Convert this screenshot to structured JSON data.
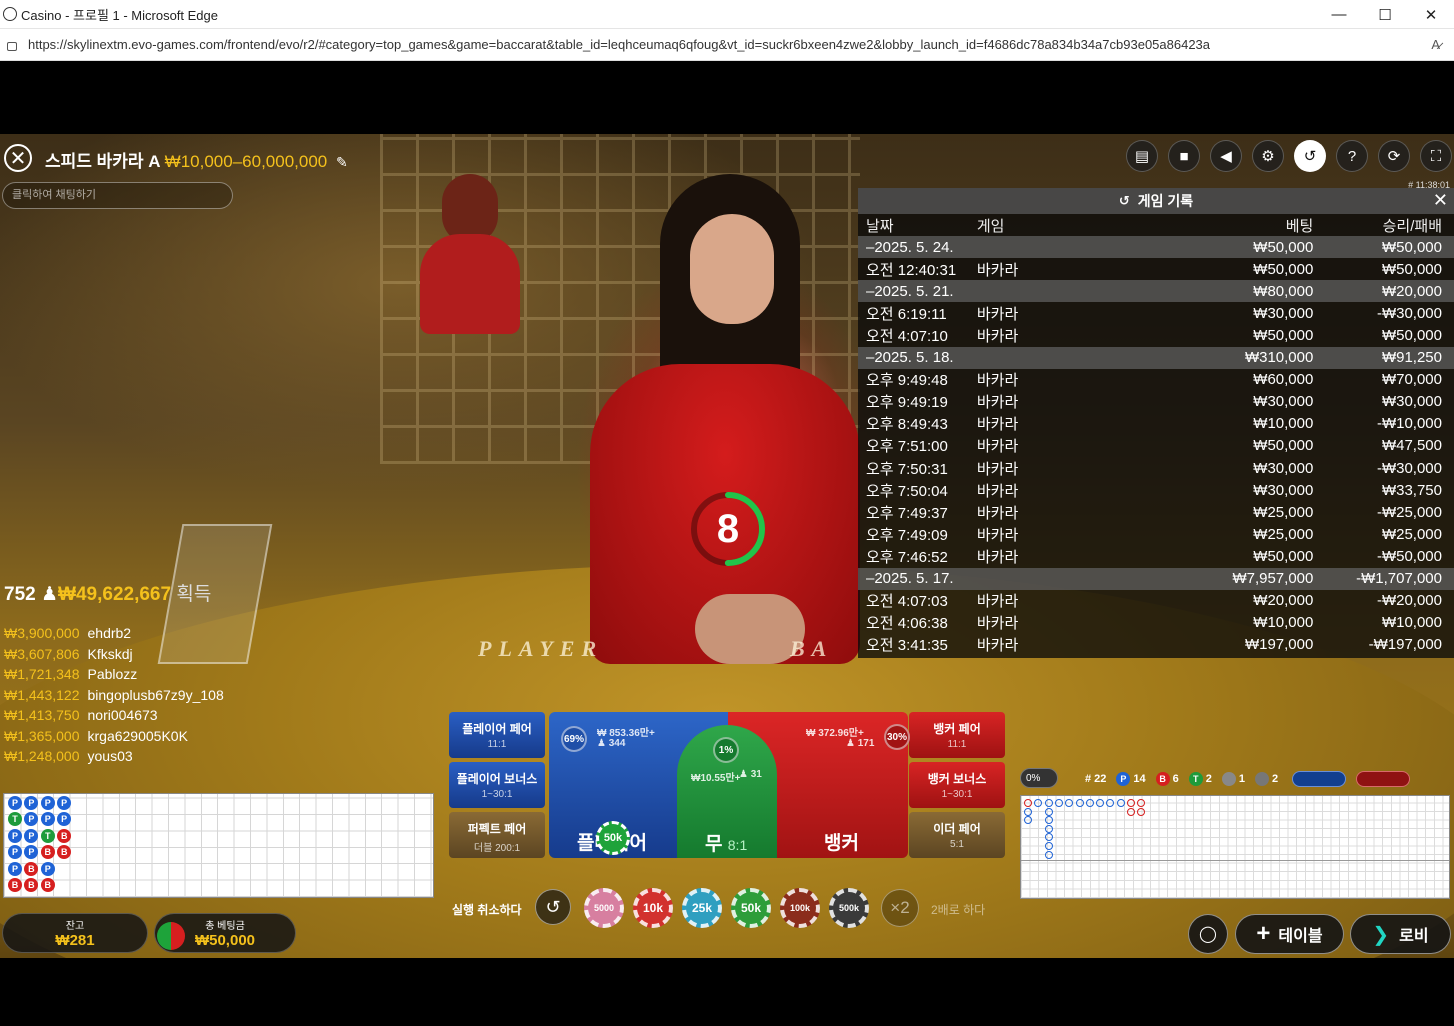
{
  "browser": {
    "title": "Casino - 프로필 1 - Microsoft Edge",
    "url": "https://skylinextm.evo-games.com/frontend/evo/r2/#category=top_games&game=baccarat&table_id=leqhceumaq6qfoug&vt_id=suckr6bxeen4zwe2&lobby_launch_id=f4686dc78a834b34a7cb93e05a86423a",
    "minimize": "—",
    "maximize": "☐",
    "close": "✕",
    "reader": "A̷"
  },
  "header": {
    "table_name": "스피드 바카라 A",
    "limits": "₩10,000–60,000,000",
    "chat_placeholder": "클릭하여 채팅하기",
    "game_id": "# 11:38:01"
  },
  "history": {
    "title": "게임 기록",
    "columns": {
      "date": "날짜",
      "game": "게임",
      "bet": "베팅",
      "result": "승리/패배"
    },
    "rows": [
      {
        "date": "–2025. 5. 24.",
        "game": "",
        "bet": "₩50,000",
        "result": "₩50,000",
        "group": true
      },
      {
        "date": "오전 12:40:31",
        "game": "바카라",
        "bet": "₩50,000",
        "result": "₩50,000"
      },
      {
        "date": "–2025. 5. 21.",
        "game": "",
        "bet": "₩80,000",
        "result": "₩20,000",
        "group": true
      },
      {
        "date": "오전 6:19:11",
        "game": "바카라",
        "bet": "₩30,000",
        "result": "-₩30,000"
      },
      {
        "date": "오전 4:07:10",
        "game": "바카라",
        "bet": "₩50,000",
        "result": "₩50,000"
      },
      {
        "date": "–2025. 5. 18.",
        "game": "",
        "bet": "₩310,000",
        "result": "₩91,250",
        "group": true
      },
      {
        "date": "오후 9:49:48",
        "game": "바카라",
        "bet": "₩60,000",
        "result": "₩70,000"
      },
      {
        "date": "오후 9:49:19",
        "game": "바카라",
        "bet": "₩30,000",
        "result": "₩30,000"
      },
      {
        "date": "오후 8:49:43",
        "game": "바카라",
        "bet": "₩10,000",
        "result": "-₩10,000"
      },
      {
        "date": "오후 7:51:00",
        "game": "바카라",
        "bet": "₩50,000",
        "result": "₩47,500"
      },
      {
        "date": "오후 7:50:31",
        "game": "바카라",
        "bet": "₩30,000",
        "result": "-₩30,000"
      },
      {
        "date": "오후 7:50:04",
        "game": "바카라",
        "bet": "₩30,000",
        "result": "₩33,750"
      },
      {
        "date": "오후 7:49:37",
        "game": "바카라",
        "bet": "₩25,000",
        "result": "-₩25,000"
      },
      {
        "date": "오후 7:49:09",
        "game": "바카라",
        "bet": "₩25,000",
        "result": "₩25,000"
      },
      {
        "date": "오후 7:46:52",
        "game": "바카라",
        "bet": "₩50,000",
        "result": "-₩50,000"
      },
      {
        "date": "–2025. 5. 17.",
        "game": "",
        "bet": "₩7,957,000",
        "result": "-₩1,707,000",
        "group": true
      },
      {
        "date": "오전 4:07:03",
        "game": "바카라",
        "bet": "₩20,000",
        "result": "-₩20,000"
      },
      {
        "date": "오전 4:06:38",
        "game": "바카라",
        "bet": "₩10,000",
        "result": "₩10,000"
      },
      {
        "date": "오전 3:41:35",
        "game": "바카라",
        "bet": "₩197,000",
        "result": "-₩197,000"
      }
    ]
  },
  "timer": {
    "value": "8",
    "fraction": 0.5
  },
  "table_words": {
    "player": "PLAYER",
    "banker": "BA"
  },
  "winners": {
    "count": "752",
    "total": "₩49,622,667",
    "label": "획득",
    "list": [
      {
        "amount": "₩3,900,000",
        "name": "ehdrb2"
      },
      {
        "amount": "₩3,607,806",
        "name": "Kfkskdj"
      },
      {
        "amount": "₩1,721,348",
        "name": "Pablozz"
      },
      {
        "amount": "₩1,443,122",
        "name": "bingoplusb67z9y_108"
      },
      {
        "amount": "₩1,413,750",
        "name": "nori004673"
      },
      {
        "amount": "₩1,365,000",
        "name": "krga629005K0K"
      },
      {
        "amount": "₩1,248,000",
        "name": "yous03"
      }
    ]
  },
  "bead_road": [
    [
      "P",
      "T",
      "P",
      "P",
      "P",
      "B"
    ],
    [
      "P",
      "P",
      "P",
      "P",
      "B",
      "B"
    ],
    [
      "P",
      "P",
      "T",
      "B",
      "P",
      "B"
    ],
    [
      "P",
      "P",
      "B",
      "B"
    ]
  ],
  "bets": {
    "player_pair": {
      "label": "플레이어 페어",
      "odds": "11:1"
    },
    "player_bonus": {
      "label": "플레이어 보너스",
      "odds": "1~30:1"
    },
    "perfect_pair": {
      "label": "퍼펙트 페어",
      "odds": "더블 200:1"
    },
    "banker_pair": {
      "label": "뱅커 페어",
      "odds": "11:1"
    },
    "banker_bonus": {
      "label": "뱅커 보너스",
      "odds": "1~30:1"
    },
    "either_pair": {
      "label": "이더 페어",
      "odds": "5:1"
    },
    "player": {
      "label": "플레이어",
      "amount": "₩ 853.36만+",
      "players": "344",
      "pct": "69%"
    },
    "tie": {
      "label": "무",
      "odds": "8:1",
      "amount": "₩10.55만+",
      "players": "31",
      "pct": "1%"
    },
    "banker": {
      "label": "뱅커",
      "amount": "₩ 372.96만+",
      "players": "171",
      "pct": "30%"
    },
    "placed_chip": "50k"
  },
  "controls": {
    "undo_label": "실행 취소하다",
    "undo_icon": "↺",
    "chips": [
      {
        "label": "5000",
        "color": "#d77fa0"
      },
      {
        "label": "10k",
        "color": "#d2312e"
      },
      {
        "label": "25k",
        "color": "#2f9fc0"
      },
      {
        "label": "50k",
        "color": "#2e9d3a"
      },
      {
        "label": "100k",
        "color": "#8b2c1c"
      },
      {
        "label": "500k",
        "color": "#3a3a3a"
      }
    ],
    "double_icon": "×2",
    "double_label": "2배로 하다"
  },
  "wallet": {
    "balance_label": "잔고",
    "balance": "₩281",
    "total_bet_label": "총 베팅금",
    "total_bet": "₩50,000"
  },
  "road_stats": {
    "pct": "0%",
    "rounds": "# 22",
    "p": "14",
    "b": "6",
    "t": "2",
    "pp": "1",
    "bp": "2",
    "p_label": "P",
    "b_label": "B",
    "t_label": "T"
  },
  "bottom_buttons": {
    "table": "테이블",
    "lobby": "로비",
    "table_icon": "+",
    "lobby_icon": "❯"
  },
  "toolbar_icons": [
    "chat-icon",
    "video-icon",
    "sound-icon",
    "settings-icon",
    "history-icon",
    "help-icon",
    "refresh-icon",
    "fullscreen-icon"
  ]
}
